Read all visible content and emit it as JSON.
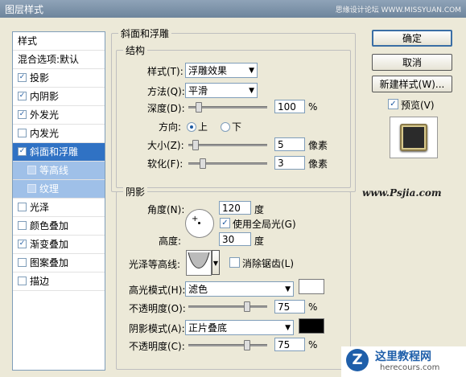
{
  "window": {
    "title": "图层样式",
    "watermark": "思缘设计论坛 WWW.MISSYUAN.COM"
  },
  "left_list": {
    "header": "样式",
    "blend": "混合选项:默认",
    "items": [
      {
        "label": "投影",
        "checked": true
      },
      {
        "label": "内阴影",
        "checked": true
      },
      {
        "label": "外发光",
        "checked": true
      },
      {
        "label": "内发光",
        "checked": false
      },
      {
        "label": "斜面和浮雕",
        "checked": true,
        "selected": true
      },
      {
        "label": "等高线",
        "checked": false,
        "sub": true
      },
      {
        "label": "纹理",
        "checked": false,
        "sub": true
      },
      {
        "label": "光泽",
        "checked": false
      },
      {
        "label": "颜色叠加",
        "checked": false
      },
      {
        "label": "渐变叠加",
        "checked": true
      },
      {
        "label": "图案叠加",
        "checked": false
      },
      {
        "label": "描边",
        "checked": false
      }
    ]
  },
  "bevel": {
    "section_title": "斜面和浮雕",
    "structure_title": "结构",
    "style_label": "样式(T):",
    "style_value": "浮雕效果",
    "technique_label": "方法(Q):",
    "technique_value": "平滑",
    "depth_label": "深度(D):",
    "depth_value": "100",
    "depth_unit": "%",
    "depth_slider": 0.1,
    "direction_label": "方向:",
    "dir_up": "上",
    "dir_down": "下",
    "size_label": "大小(Z):",
    "size_value": "5",
    "size_unit": "像素",
    "size_slider": 0.05,
    "soften_label": "软化(F):",
    "soften_value": "3",
    "soften_unit": "像素",
    "soften_slider": 0.15
  },
  "shading": {
    "title": "阴影",
    "angle_label": "角度(N):",
    "angle_value": "120",
    "angle_unit": "度",
    "global_light_label": "使用全局光(G)",
    "global_light_checked": true,
    "altitude_label": "高度:",
    "altitude_value": "30",
    "altitude_unit": "度",
    "gloss_label": "光泽等高线:",
    "antialias_label": "消除锯齿(L)",
    "highlight_mode_label": "高光模式(H):",
    "highlight_mode_value": "滤色",
    "highlight_color": "#ffffff",
    "hl_opacity_label": "不透明度(O):",
    "hl_opacity_value": "75",
    "hl_opacity_slider": 0.75,
    "shadow_mode_label": "阴影模式(A):",
    "shadow_mode_value": "正片叠底",
    "shadow_color": "#000000",
    "sh_opacity_label": "不透明度(C):",
    "sh_opacity_value": "75",
    "sh_opacity_slider": 0.75,
    "percent": "%"
  },
  "buttons": {
    "ok": "确定",
    "cancel": "取消",
    "new_style": "新建样式(W)...",
    "preview": "预览(V)"
  },
  "site_url": "www.Psjia.com",
  "logo": {
    "title": "这里教程网",
    "sub": "herecours.com",
    "letter": "Z"
  }
}
